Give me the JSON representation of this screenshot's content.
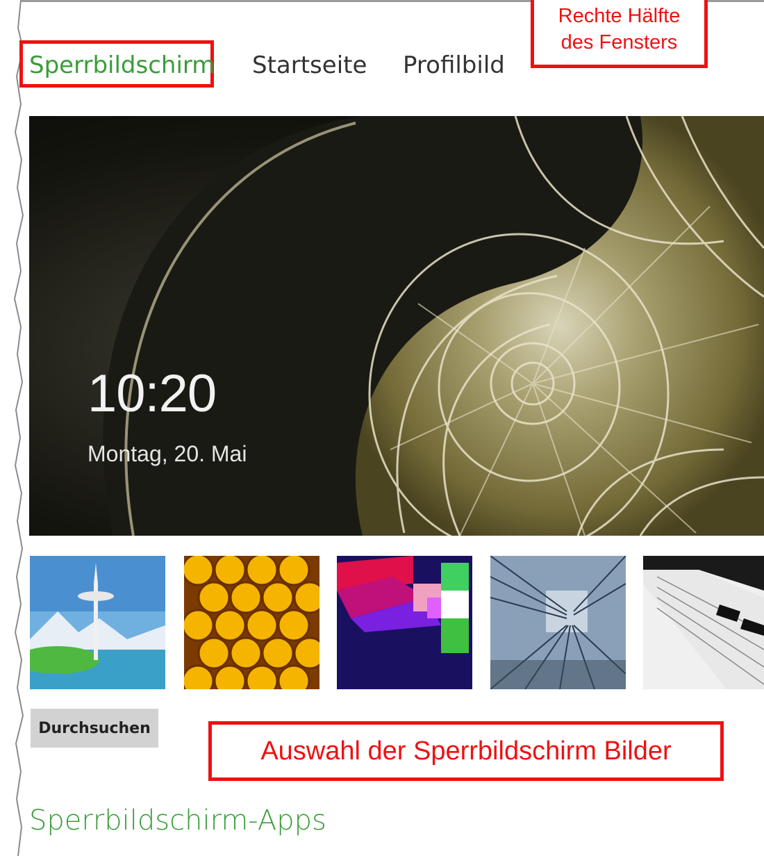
{
  "tabs": [
    {
      "label": "Sperrbildschirm",
      "active": true
    },
    {
      "label": "Startseite",
      "active": false
    },
    {
      "label": "Profilbild",
      "active": false
    }
  ],
  "annotations": {
    "window_half": "Rechte Hälfte des Fensters",
    "window_half_line1": "Rechte Hälfte",
    "window_half_line2": "des Fensters",
    "image_selection": "Auswahl der Sperrbildschirm Bilder"
  },
  "preview": {
    "time": "10:20",
    "date": "Montag, 20. Mai"
  },
  "thumbnails": [
    {
      "name": "thumbnail-space-needle"
    },
    {
      "name": "thumbnail-honeycomb"
    },
    {
      "name": "thumbnail-colorful-shapes"
    },
    {
      "name": "thumbnail-tunnel"
    },
    {
      "name": "thumbnail-piano"
    }
  ],
  "browse_button": "Durchsuchen",
  "section_title": "Sperrbildschirm-Apps",
  "colors": {
    "accent_green": "#3a9c3a",
    "annotation_red": "#ee1111"
  }
}
